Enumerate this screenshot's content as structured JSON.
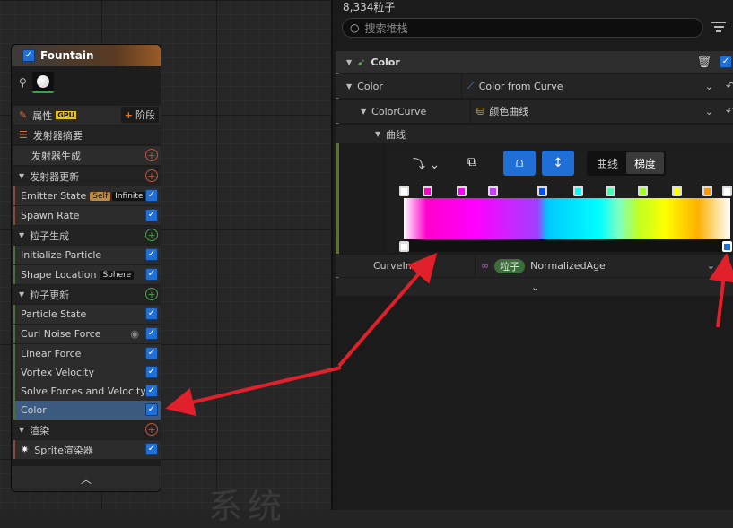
{
  "graph": {
    "watermark": "系统"
  },
  "node": {
    "title": "Fountain",
    "rows": {
      "props": {
        "label": "属性",
        "gpu": "GPU",
        "stage": "阶段"
      },
      "summary": "发射器摘要",
      "emitter_spawn": "发射器生成",
      "emitter_update": "发射器更新",
      "emitter_state": {
        "label": "Emitter State",
        "tag1": "Self",
        "tag2": "Infinite"
      },
      "spawn_rate": "Spawn Rate",
      "particle_spawn": "粒子生成",
      "init_particle": "Initialize Particle",
      "shape_location": {
        "label": "Shape Location",
        "tag": "Sphere"
      },
      "particle_update": "粒子更新",
      "particle_state": "Particle State",
      "curl_noise": "Curl Noise Force",
      "linear_force": "Linear Force",
      "vortex_velocity": "Vortex Velocity",
      "solve_forces": "Solve Forces and Velocity",
      "color": "Color",
      "render": "渲染",
      "sprite": "Sprite渲染器"
    }
  },
  "panel": {
    "count": "8,334粒子",
    "search_placeholder": "搜索堆栈",
    "section_title": "Color",
    "color_row": {
      "label": "Color",
      "value": "Color from Curve"
    },
    "curve_row": {
      "label": "ColorCurve",
      "value": "颜色曲线"
    },
    "curve_sub": "曲线",
    "toggle": {
      "a": "曲线",
      "b": "梯度"
    },
    "curve_index": {
      "label": "CurveIndex",
      "pill": "粒子",
      "value": "NormalizedAge"
    }
  },
  "colors": {
    "accent": "#1f6fd6",
    "arrow": "#e0202a",
    "stops": [
      "#ff00cc",
      "#ff00ff",
      "#c040ff",
      "#0050ff",
      "#00ffff",
      "#40ffb0",
      "#a0ff20",
      "#ffff00",
      "#ff9900"
    ]
  }
}
